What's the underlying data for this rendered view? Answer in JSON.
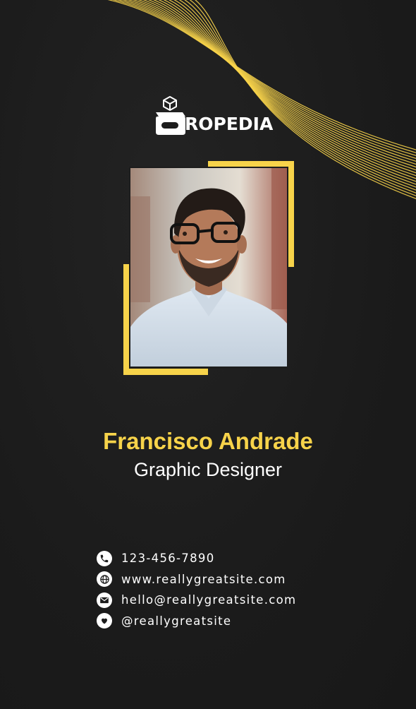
{
  "brand": {
    "logo_text": "ROPEDIA",
    "logo_icon": "package-box-icon"
  },
  "profile": {
    "name": "Francisco Andrade",
    "role": "Graphic Designer",
    "photo": "portrait-photo"
  },
  "contacts": [
    {
      "icon": "phone-icon",
      "text": "123-456-7890"
    },
    {
      "icon": "globe-icon",
      "text": "www.reallygreatsite.com"
    },
    {
      "icon": "mail-icon",
      "text": "hello@reallygreatsite.com"
    },
    {
      "icon": "heart-icon",
      "text": "@reallygreatsite"
    }
  ],
  "colors": {
    "background": "#1c1c1c",
    "accent": "#f7d34a",
    "text": "#ffffff"
  }
}
